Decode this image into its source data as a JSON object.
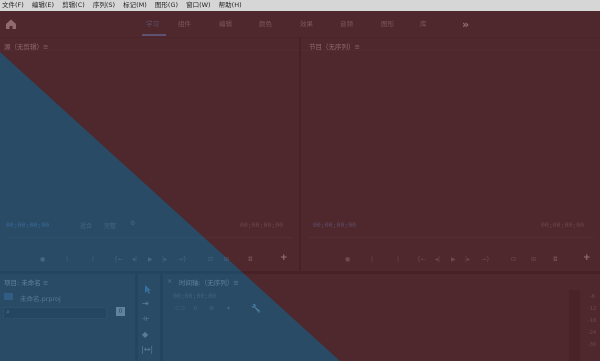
{
  "menu": [
    "文件(F)",
    "编辑(E)",
    "剪辑(C)",
    "序列(S)",
    "标记(M)",
    "图形(G)",
    "窗口(W)",
    "帮助(H)"
  ],
  "workspaces": [
    "学习",
    "组件",
    "编辑",
    "颜色",
    "效果",
    "音频",
    "图形",
    "库"
  ],
  "active_workspace": "学习",
  "source_monitor": {
    "title": "源（无剪辑）≡",
    "timecode_left": "00;00;00;00",
    "timecode_right": "00;00;00;00",
    "fit_label": "适合",
    "zoom_label": "完整"
  },
  "program_monitor": {
    "title": "节目（无序列）≡",
    "timecode_left": "00;00;00;00",
    "timecode_right": "00;00;00;00"
  },
  "project_panel": {
    "title": "项目: 未命名 ≡",
    "file_name": "未命名.prproj",
    "badge": "0"
  },
  "timeline": {
    "close": "×",
    "title": "时间轴:（无序列）≡",
    "timecode": "00;00;00;00"
  },
  "audio_meter_labels": [
    "-6",
    "-12",
    "-18",
    "-24",
    "-30"
  ],
  "colors": {
    "accent": "#4a8fd6",
    "overlay_red": "#6b2b33",
    "overlay_blue": "#2e5f86"
  }
}
